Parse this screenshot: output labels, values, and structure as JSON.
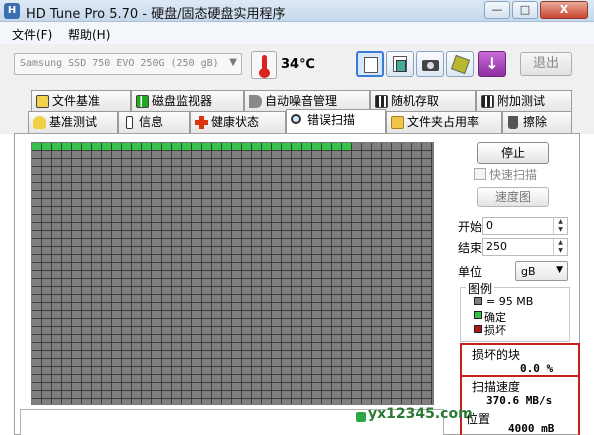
{
  "window": {
    "title": "HD Tune Pro 5.70 - 硬盘/固态硬盘实用程序",
    "minimize": "—",
    "maximize": "□",
    "close": "X"
  },
  "menu": [
    {
      "label": "文件(F)"
    },
    {
      "label": "帮助(H)"
    }
  ],
  "toolbar": {
    "drive": "Samsung SSD 750 EVO 250G (250 gB)",
    "temperature": "34℃",
    "exit_label": "退出"
  },
  "tabs_top": [
    {
      "label": "文件基准",
      "icon": "file-benchmark-icon"
    },
    {
      "label": "磁盘监视器",
      "icon": "disk-monitor-icon"
    },
    {
      "label": "自动噪音管理",
      "icon": "speaker-icon"
    },
    {
      "label": "随机存取",
      "icon": "random-access-icon"
    },
    {
      "label": "附加测试",
      "icon": "extra-tests-icon"
    }
  ],
  "tabs_bottom": [
    {
      "label": "基准测试",
      "icon": "lightbulb-icon"
    },
    {
      "label": "信息",
      "icon": "info-icon"
    },
    {
      "label": "健康状态",
      "icon": "health-cross-icon"
    },
    {
      "label": "错误扫描",
      "icon": "magnifier-icon",
      "active": true
    },
    {
      "label": "文件夹占用率",
      "icon": "folder-icon"
    },
    {
      "label": "擦除",
      "icon": "trash-icon"
    }
  ],
  "scan": {
    "stop_label": "停止",
    "quick_scan_label": "快速扫描",
    "quick_scan_checked": false,
    "speed_map_label": "速度图",
    "start_label": "开始",
    "start_value": "0",
    "end_label": "结束",
    "end_value": "250",
    "unit_label": "单位",
    "unit_value": "gB",
    "legend_title": "图例",
    "legend": [
      {
        "text": "= 95 MB",
        "color": "#7f7f7f"
      },
      {
        "text": "确定",
        "color": "#34c24a"
      },
      {
        "text": "损坏",
        "color": "#b01818"
      }
    ],
    "damaged_blocks_label": "损坏的块",
    "damaged_blocks_value": "0.0 %",
    "scan_speed_label": "扫描速度",
    "scan_speed_value": "370.6 MB/s",
    "position_label": "位置",
    "position_value": "4000 mB"
  },
  "grid": {
    "columns": 40,
    "rows": 33,
    "completed_blocks": 32
  },
  "colors": {
    "block_ok": "#34c24a",
    "block_pending": "#7f7f7f",
    "highlight_box": "#c81e1e"
  },
  "watermark": "yx12345.com"
}
